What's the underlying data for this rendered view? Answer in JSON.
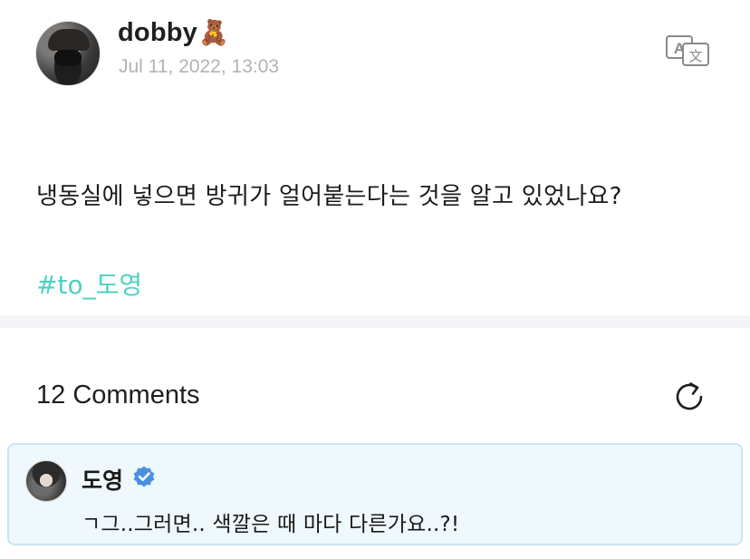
{
  "post": {
    "author": "dobby",
    "author_emoji": "🧸",
    "timestamp": "Jul 11, 2022, 13:03",
    "body": "냉동실에 넣으면 방귀가 얼어붙는다는 것을 알고 있었나요?",
    "hashtag": "#to_도영",
    "translate_icon": "translate-icon"
  },
  "comments": {
    "count_label": "12 Comments",
    "refresh_icon": "refresh-icon",
    "items": [
      {
        "author": "도영",
        "verified": true,
        "text": "ㄱ그..그러면.. 색깔은 때 마다 다른가요..?!"
      }
    ]
  },
  "colors": {
    "hashtag": "#4fd1c0",
    "timestamp": "#b3b3b3",
    "comment_bg": "#eef8fd",
    "comment_border": "#c9e6f3",
    "verified": "#4a90e2",
    "separator": "#f5f5f7"
  }
}
